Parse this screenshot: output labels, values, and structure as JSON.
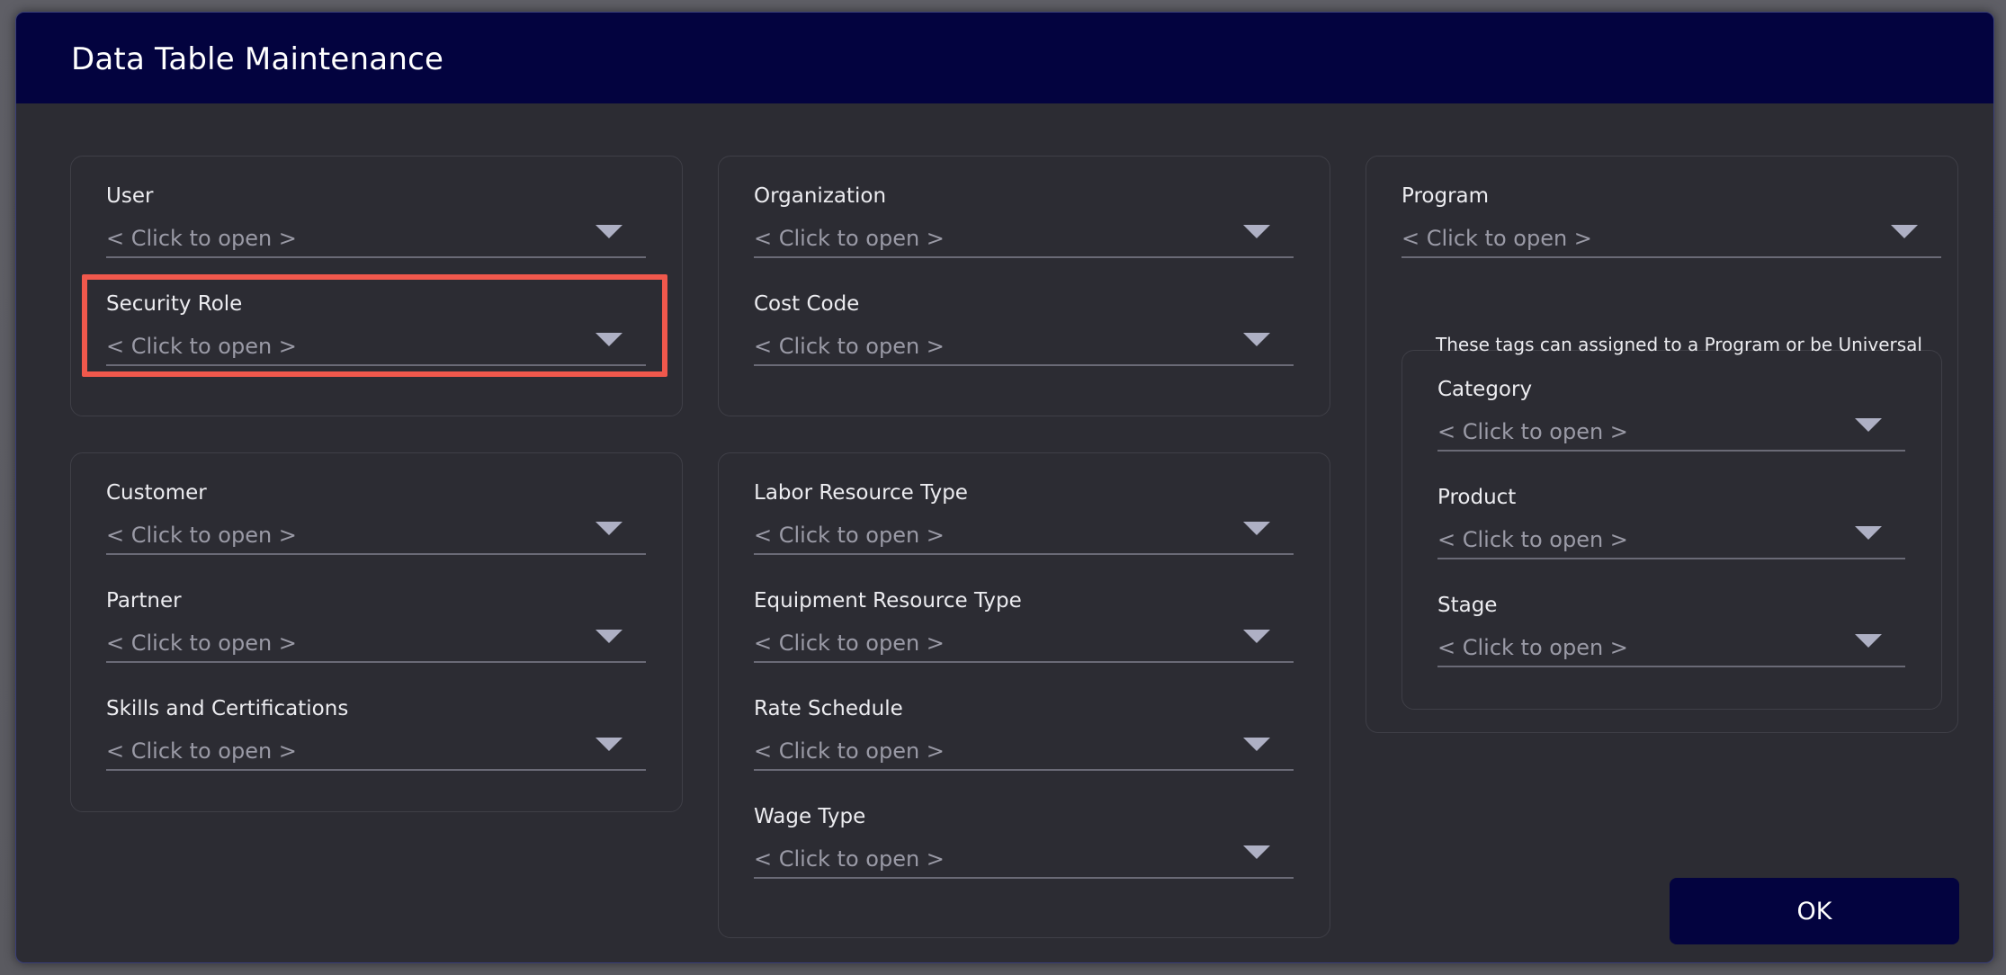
{
  "dialog": {
    "title": "Data Table Maintenance",
    "ok_label": "OK",
    "tags_note": "These tags can assigned to a Program or be Universal"
  },
  "fields": {
    "user": {
      "label": "User",
      "value": "< Click to open >"
    },
    "security_role": {
      "label": "Security Role",
      "value": "< Click to open >"
    },
    "customer": {
      "label": "Customer",
      "value": "< Click to open >"
    },
    "partner": {
      "label": "Partner",
      "value": "< Click to open >"
    },
    "skills": {
      "label": "Skills and Certifications",
      "value": "< Click to open >"
    },
    "organization": {
      "label": "Organization",
      "value": "< Click to open >"
    },
    "cost_code": {
      "label": "Cost Code",
      "value": "< Click to open >"
    },
    "labor_resource_type": {
      "label": "Labor Resource Type",
      "value": "< Click to open >"
    },
    "equipment_resource_type": {
      "label": "Equipment Resource Type",
      "value": "< Click to open >"
    },
    "rate_schedule": {
      "label": "Rate Schedule",
      "value": "< Click to open >"
    },
    "wage_type": {
      "label": "Wage Type",
      "value": "< Click to open >"
    },
    "program": {
      "label": "Program",
      "value": "< Click to open >"
    },
    "category": {
      "label": "Category",
      "value": "< Click to open >"
    },
    "product": {
      "label": "Product",
      "value": "< Click to open >"
    },
    "stage": {
      "label": "Stage",
      "value": "< Click to open >"
    }
  },
  "colors": {
    "titlebar": "#03033f",
    "dialog_bg": "#2c2c33",
    "highlight": "#f0584c"
  }
}
